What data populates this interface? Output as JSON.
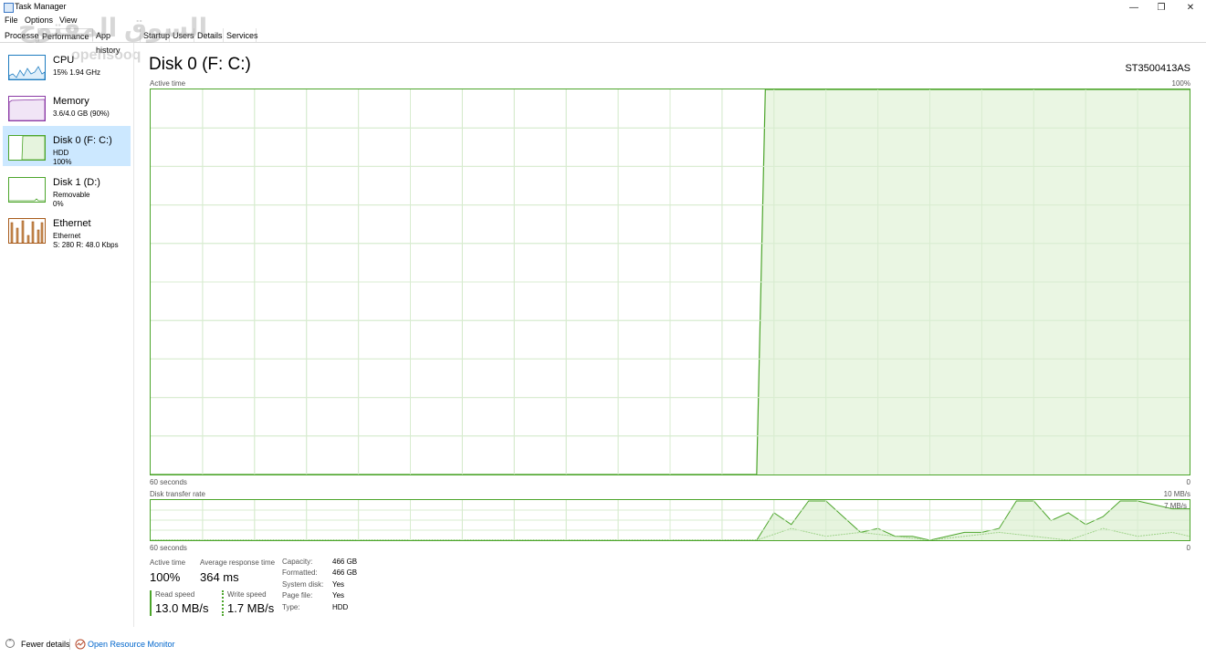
{
  "window": {
    "title": "Task Manager",
    "controls": [
      "—",
      "❐",
      "✕"
    ]
  },
  "menu": [
    "File",
    "Options",
    "View"
  ],
  "tabs": [
    "Processes",
    "Performance",
    "App history",
    "Startup",
    "Users",
    "Details",
    "Services"
  ],
  "watermark": {
    "main": "السوق المفتوح",
    "sub": "opensooq"
  },
  "sidebar": {
    "items": [
      {
        "name": "CPU",
        "sub1": "15% 1.94 GHz",
        "sub2": "",
        "color": "#1e7cc0",
        "selected": false
      },
      {
        "name": "Memory",
        "sub1": "3.6/4.0 GB (90%)",
        "sub2": "",
        "color": "#8b3aa5",
        "selected": false
      },
      {
        "name": "Disk 0 (F: C:)",
        "sub1": "HDD",
        "sub2": "100%",
        "color": "#4ca52b",
        "selected": true
      },
      {
        "name": "Disk 1 (D:)",
        "sub1": "Removable",
        "sub2": "0%",
        "color": "#4ca52b",
        "selected": false
      },
      {
        "name": "Ethernet",
        "sub1": "Ethernet",
        "sub2": "S: 280  R: 48.0 Kbps",
        "color": "#a75a1a",
        "selected": false
      }
    ]
  },
  "main": {
    "title": "Disk 0 (F: C:)",
    "model": "ST3500413AS",
    "active_chart": {
      "label": "Active time",
      "max_label": "100%",
      "time_label": "60 seconds",
      "min_label": "0"
    },
    "transfer_chart": {
      "label": "Disk transfer rate",
      "max_label": "10 MB/s",
      "sub_label": "7 MB/s",
      "time_label": "60 seconds",
      "min_label": "0"
    },
    "stats": {
      "active_time_label": "Active time",
      "active_time_value": "100%",
      "response_label": "Average response time",
      "response_value": "364 ms",
      "read_label": "Read speed",
      "read_value": "13.0 MB/s",
      "write_label": "Write speed",
      "write_value": "1.7 MB/s"
    },
    "properties": [
      {
        "label": "Capacity:",
        "value": "466 GB"
      },
      {
        "label": "Formatted:",
        "value": "466 GB"
      },
      {
        "label": "System disk:",
        "value": "Yes"
      },
      {
        "label": "Page file:",
        "value": "Yes"
      },
      {
        "label": "Type:",
        "value": "HDD"
      }
    ]
  },
  "footer": {
    "fewer_details": "Fewer details",
    "open_resource_monitor": "Open Resource Monitor"
  },
  "colors": {
    "disk_line": "#4ca52b",
    "disk_fill": "#e6f4de",
    "grid": "#d8ecd0",
    "selected": "#cce8ff",
    "link": "#0066cc"
  },
  "chart_data": [
    {
      "type": "area",
      "title": "Active time",
      "ylim": [
        0,
        100
      ],
      "unit": "%",
      "x_span_seconds": 60,
      "x": [
        0,
        10,
        20,
        30,
        35,
        35.5,
        40,
        50,
        60
      ],
      "values": [
        0,
        0,
        0,
        0,
        0,
        100,
        100,
        100,
        100
      ]
    },
    {
      "type": "line",
      "title": "Disk transfer rate",
      "ylim": [
        0,
        10
      ],
      "unit": "MB/s",
      "x_span_seconds": 60,
      "series": [
        {
          "name": "Read speed",
          "x": [
            0,
            35,
            36,
            37,
            38,
            39,
            40,
            41,
            42,
            43,
            44,
            45,
            46,
            47,
            48,
            49,
            50,
            51,
            52,
            53,
            54,
            55,
            56,
            57,
            58,
            59,
            60
          ],
          "values": [
            0,
            0,
            7,
            4,
            10,
            10,
            6,
            2,
            3,
            1,
            1,
            0,
            1,
            2,
            2,
            3,
            10,
            10,
            5,
            7,
            4,
            6,
            10,
            10,
            9,
            8,
            8
          ]
        },
        {
          "name": "Write speed",
          "x": [
            0,
            35,
            37,
            39,
            41,
            43,
            45,
            47,
            49,
            51,
            53,
            55,
            57,
            59,
            60
          ],
          "values": [
            0,
            0,
            3,
            1,
            2,
            1,
            0,
            1,
            2,
            1,
            0,
            3,
            1,
            2,
            1
          ]
        }
      ]
    }
  ]
}
